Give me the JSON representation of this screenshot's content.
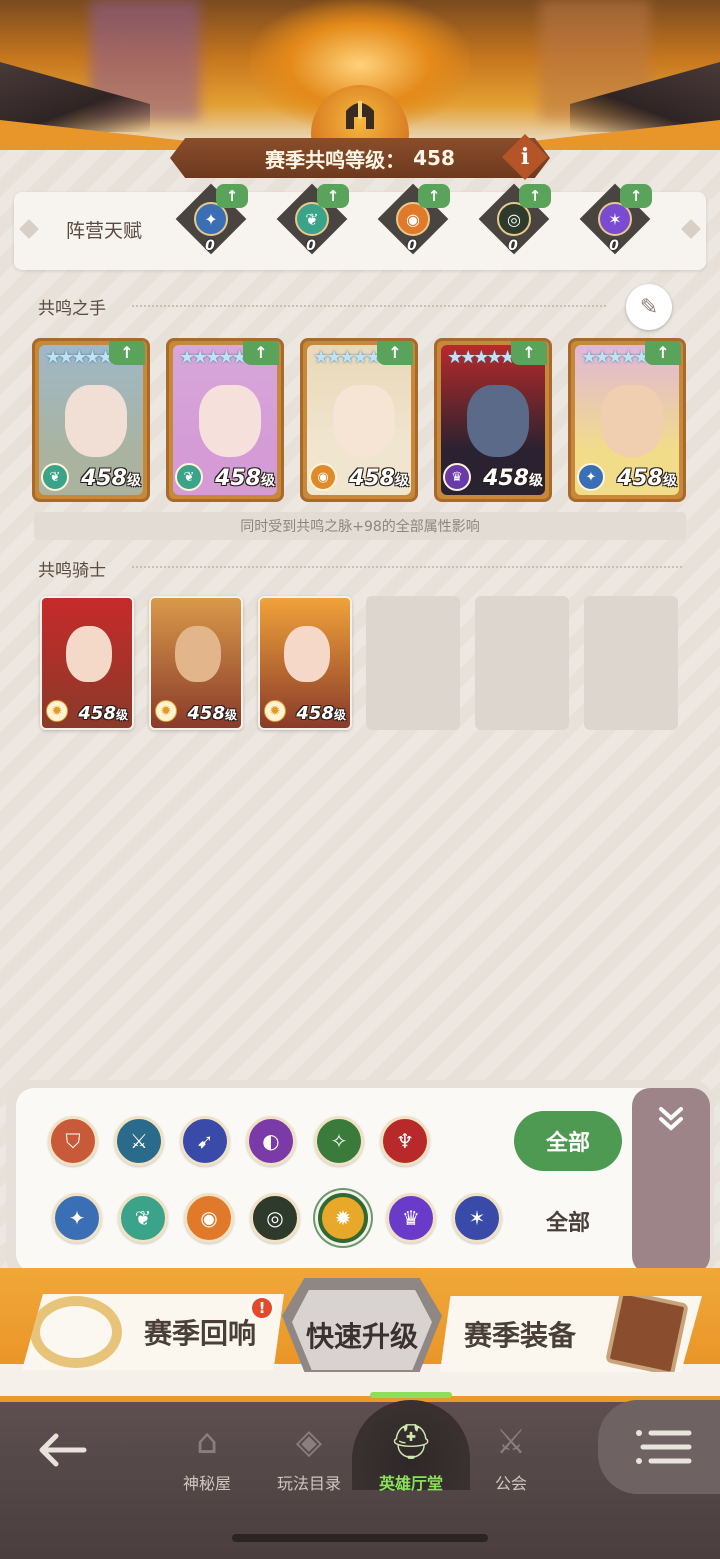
{
  "header": {
    "level_label": "赛季共鸣等级：",
    "level_value": "458",
    "info_icon": "info-icon",
    "emblem_icon": "spartan-helmet-icon"
  },
  "faction_talents": {
    "title": "阵营天赋",
    "items": [
      {
        "icon": "lightbearer-icon",
        "count": "0",
        "color": "#3b6fb5",
        "glyph": "✦"
      },
      {
        "icon": "wilder-icon",
        "count": "0",
        "color": "#3aa38a",
        "glyph": "❦"
      },
      {
        "icon": "graveborn-icon",
        "count": "0",
        "color": "#e07a2a",
        "glyph": "◉"
      },
      {
        "icon": "mauler-icon",
        "count": "0",
        "color": "#2d3a2c",
        "glyph": "◎"
      },
      {
        "icon": "celestial-hypogean-icon",
        "count": "0",
        "color": "#7a4ad0",
        "glyph": "✶"
      }
    ]
  },
  "resonance_hands": {
    "title": "共鸣之手",
    "heroes": [
      {
        "level": "458",
        "level_unit": "级",
        "faction_color": "#3aa38a",
        "faction_glyph": "❦",
        "bg": "#9fb8c8",
        "face": "#f1dfd5",
        "hair": "#a9b3a0"
      },
      {
        "level": "458",
        "level_unit": "级",
        "faction_color": "#3aa38a",
        "faction_glyph": "❦",
        "bg": "#d7a8d8",
        "face": "#f6e0dc",
        "hair": "#d49bd7"
      },
      {
        "level": "458",
        "level_unit": "级",
        "faction_color": "#e08a2a",
        "faction_glyph": "◉",
        "bg": "#e9d8b8",
        "face": "#f6e4d4",
        "hair": "#f0e6d0"
      },
      {
        "level": "458",
        "level_unit": "级",
        "faction_color": "#6a3aa8",
        "faction_glyph": "♛",
        "bg": "#b72a2a",
        "face": "#5b6a88",
        "hair": "#2a2230"
      },
      {
        "level": "458",
        "level_unit": "级",
        "faction_color": "#3b6fb5",
        "faction_glyph": "✦",
        "bg": "#e0b7d8",
        "face": "#efcfb0",
        "hair": "#f1dc8a"
      }
    ],
    "note": "同时受到共鸣之脉+98的全部属性影响"
  },
  "resonance_knights": {
    "title": "共鸣骑士",
    "knights": [
      {
        "level": "458",
        "level_unit": "级",
        "bg": "#c72a2a",
        "face": "#f4d8c8"
      },
      {
        "level": "458",
        "level_unit": "级",
        "bg": "#d99a4a",
        "face": "#e2b68a"
      },
      {
        "level": "458",
        "level_unit": "级",
        "bg": "#f0a23a",
        "face": "#f6d8c8"
      }
    ],
    "empty_slots": 3
  },
  "filters": {
    "class_row": [
      {
        "icon": "tank-shield-icon",
        "color": "#c85a3a",
        "glyph": "⛉"
      },
      {
        "icon": "warrior-icon",
        "color": "#2a6a8a",
        "glyph": "⚔"
      },
      {
        "icon": "ranger-bow-icon",
        "color": "#3a4aa8",
        "glyph": "➹"
      },
      {
        "icon": "mage-icon",
        "color": "#7a3aa8",
        "glyph": "◐"
      },
      {
        "icon": "support-icon",
        "color": "#3a7a3a",
        "glyph": "✧"
      },
      {
        "icon": "berserker-icon",
        "color": "#b82a2a",
        "glyph": "♆"
      }
    ],
    "faction_row": [
      {
        "icon": "lightbearer-icon",
        "color": "#3b6fb5",
        "glyph": "✦"
      },
      {
        "icon": "wilder-icon",
        "color": "#3aa38a",
        "glyph": "❦"
      },
      {
        "icon": "graveborn-icon",
        "color": "#e07a2a",
        "glyph": "◉"
      },
      {
        "icon": "mauler-icon",
        "color": "#2d3a2c",
        "glyph": "◎"
      },
      {
        "icon": "dimensional-icon",
        "color": "#e8a82a",
        "glyph": "✹"
      },
      {
        "icon": "hypogean-icon",
        "color": "#6a3ac8",
        "glyph": "♛"
      },
      {
        "icon": "celestial-icon",
        "color": "#3a4aa8",
        "glyph": "✶"
      }
    ],
    "all_active": "全部",
    "all": "全部",
    "collapse_icon": "double-chevron-down-icon"
  },
  "modes": {
    "left": "赛季回响",
    "center": "快速升级",
    "right": "赛季装备",
    "badge": "!"
  },
  "nav": {
    "back_icon": "back-arrow-icon",
    "items": [
      {
        "label": "神秘屋",
        "icon": "mystery-house-icon"
      },
      {
        "label": "玩法目录",
        "icon": "game-modes-icon"
      },
      {
        "label": "英雄厅堂",
        "icon": "hero-hall-icon"
      },
      {
        "label": "公会",
        "icon": "guild-icon"
      }
    ],
    "menu_icon": "menu-list-icon"
  }
}
